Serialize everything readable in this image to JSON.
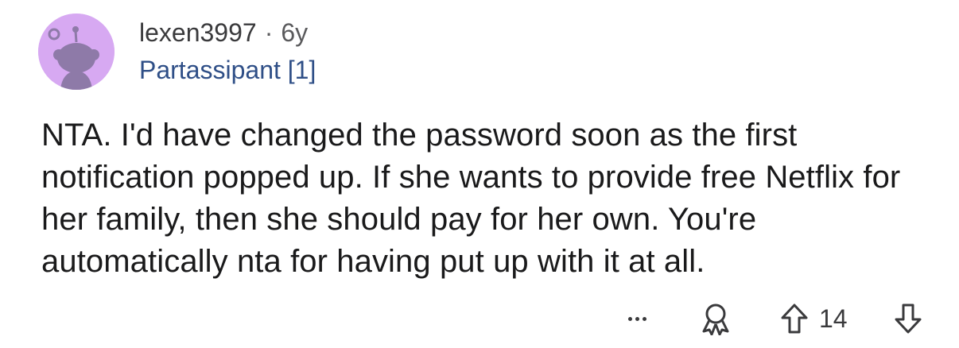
{
  "comment": {
    "author": "lexen3997",
    "separator": "·",
    "age": "6y",
    "flair": "Partassipant [1]",
    "body": "NTA. I'd have changed the password soon as the first notification popped up. If she wants to provide free Netflix for her family, then she should pay for her own. You're automatically nta for having put up with it at all.",
    "score": "14",
    "avatar_color": "#d7a9f2",
    "flair_color": "#2f4f87"
  },
  "actions": {
    "more_icon": "more-options-icon",
    "award_icon": "award-icon",
    "upvote_icon": "upvote-arrow-icon",
    "downvote_icon": "downvote-arrow-icon"
  }
}
